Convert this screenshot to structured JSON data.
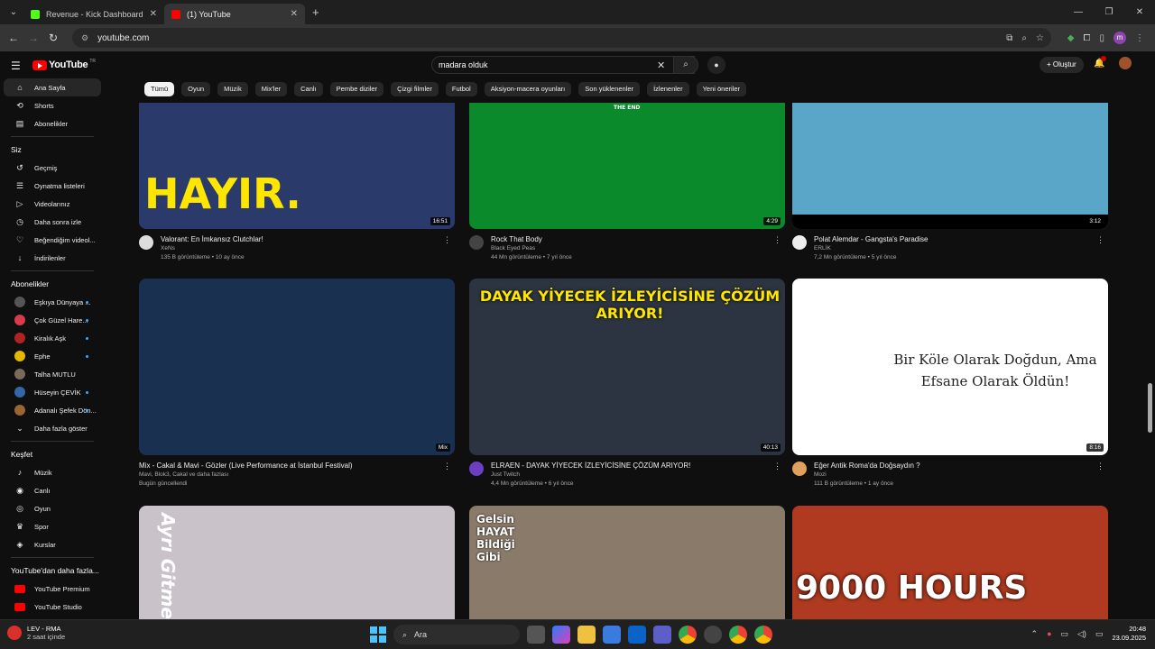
{
  "browser": {
    "tabs": [
      {
        "title": "Revenue - Kick Dashboard",
        "active": false,
        "favicon_color": "#53fc18"
      },
      {
        "title": "(1) YouTube",
        "active": true,
        "favicon_color": "#ff0000"
      }
    ],
    "url": "youtube.com",
    "profile_initial": "m"
  },
  "header": {
    "logo_text": "YouTube",
    "logo_country": "TR",
    "search_value": "madara olduk",
    "create_label": "Oluştur"
  },
  "chips": [
    "Tümü",
    "Oyun",
    "Müzik",
    "Mix'ler",
    "Canlı",
    "Pembe diziler",
    "Çizgi filmler",
    "Futbol",
    "Aksiyon-macera oyunları",
    "Son yüklenenler",
    "İzlenenler",
    "Yeni öneriler"
  ],
  "sidebar": {
    "main": [
      {
        "label": "Ana Sayfa",
        "icon": "home-icon",
        "glyph": "⌂"
      },
      {
        "label": "Shorts",
        "icon": "shorts-icon",
        "glyph": "⟲"
      },
      {
        "label": "Abonelikler",
        "icon": "subscriptions-icon",
        "glyph": "▤"
      }
    ],
    "you_header": "Siz",
    "you": [
      {
        "label": "Geçmiş",
        "icon": "history-icon",
        "glyph": "↺"
      },
      {
        "label": "Oynatma listeleri",
        "icon": "playlist-icon",
        "glyph": "☰"
      },
      {
        "label": "Videolarınız",
        "icon": "your-videos-icon",
        "glyph": "▷"
      },
      {
        "label": "Daha sonra izle",
        "icon": "watch-later-icon",
        "glyph": "◷"
      },
      {
        "label": "Beğendiğim videol...",
        "icon": "liked-icon",
        "glyph": "♡"
      },
      {
        "label": "İndirilenler",
        "icon": "download-icon",
        "glyph": "↓"
      }
    ],
    "subs_header": "Abonelikler",
    "subs": [
      {
        "label": "Eşkıya Dünyaya ...",
        "color": "#555555",
        "live": true
      },
      {
        "label": "Çok Güzel Hare...",
        "color": "#d83b4b",
        "live": true
      },
      {
        "label": "Kiralık Aşk",
        "color": "#b22222",
        "live": true
      },
      {
        "label": "Ephe",
        "color": "#e6b800",
        "live": true
      },
      {
        "label": "Talha MUTLU",
        "color": "#7a6a5a",
        "live": false
      },
      {
        "label": "Hüseyin ÇEVİK",
        "color": "#3366aa",
        "live": true
      },
      {
        "label": "Adanalı Şefek Dön...",
        "color": "#996633",
        "live": true
      }
    ],
    "more_label": "Daha fazla göster",
    "explore_header": "Keşfet",
    "explore": [
      {
        "label": "Müzik",
        "icon": "music-icon",
        "glyph": "♪"
      },
      {
        "label": "Canlı",
        "icon": "live-icon",
        "glyph": "◉"
      },
      {
        "label": "Oyun",
        "icon": "gaming-icon",
        "glyph": "◎"
      },
      {
        "label": "Spor",
        "icon": "sports-icon",
        "glyph": "♛"
      },
      {
        "label": "Kurslar",
        "icon": "courses-icon",
        "glyph": "◈"
      }
    ],
    "more_yt_header": "YouTube'dan daha fazla...",
    "more_yt": [
      {
        "label": "YouTube Premium",
        "color": "#ff0000"
      },
      {
        "label": "YouTube Studio",
        "color": "#ff0000"
      }
    ]
  },
  "videos": [
    {
      "title": "Valorant: En İmkansız Clutchlar!",
      "channel": "XeNs",
      "stats": "135 B görüntüleme • 10 ay önce",
      "duration": "16:51",
      "overlay": "HAYIR.",
      "thumb_bg": "#2a3a6a",
      "ch_color": "#ddd"
    },
    {
      "title": "Rock That Body",
      "channel": "Black Eyed Peas",
      "stats": "44 Mn görüntüleme • 7 yıl önce",
      "duration": "4:29",
      "overlay": "THE END",
      "thumb_bg": "#0a8a2a",
      "ch_color": "#444"
    },
    {
      "title": "Polat Alemdar - Gangsta's Paradise",
      "channel": "ERLİK",
      "stats": "7,2 Mn görüntüleme • 5 yıl önce",
      "duration": "3:12",
      "overlay": "",
      "thumb_bg": "#5aa6c8",
      "ch_color": "#eee"
    },
    {
      "title": "Mix - Cakal & Mavi - Gözler (Live Performance at İstanbul Festival)",
      "channel": "Mavi, Blok3, Cakal ve daha fazlası",
      "stats": "Bugün güncellendi",
      "duration": "Mix",
      "overlay": "",
      "thumb_bg": "#1a3050",
      "ch_color": ""
    },
    {
      "title": "ELRAEN - DAYAK YİYECEK İZLEYİCİSİNE ÇÖZÜM ARIYOR!",
      "channel": "Just Twitch",
      "stats": "4,4 Mn görüntüleme • 6 yıl önce",
      "duration": "40:13",
      "overlay": "DAYAK YİYECEK İZLEYİCİSİNE ÇÖZÜM ARIYOR!",
      "thumb_bg": "#2b3440",
      "ch_color": "#6a3fc0"
    },
    {
      "title": "Eğer Antik Roma'da Doğsaydın ?",
      "channel": "Mozi",
      "stats": "111 B görüntüleme • 1 ay önce",
      "duration": "8:16",
      "overlay": "Bir Köle Olarak Doğdun, Ama Efsane Olarak Öldün!",
      "thumb_bg": "#ffffff",
      "ch_color": "#e0a060"
    },
    {
      "title": "",
      "channel": "",
      "stats": "",
      "duration": "",
      "overlay": "Ayrı Gitme",
      "thumb_bg": "#c9c2c8",
      "ch_color": ""
    },
    {
      "title": "",
      "channel": "",
      "stats": "",
      "duration": "",
      "overlay": "Gelsin HAYAT Bildiği Gibi",
      "thumb_bg": "#8a7a6a",
      "ch_color": ""
    },
    {
      "title": "",
      "channel": "",
      "stats": "",
      "duration": "",
      "overlay": "9000 HOURS",
      "thumb_bg": "#b03a20",
      "ch_color": ""
    }
  ],
  "taskbar": {
    "weather_title": "LEV - RMA",
    "weather_sub": "2 saat içinde",
    "search_placeholder": "Ara",
    "time": "20:48",
    "date": "23.09.2025"
  }
}
